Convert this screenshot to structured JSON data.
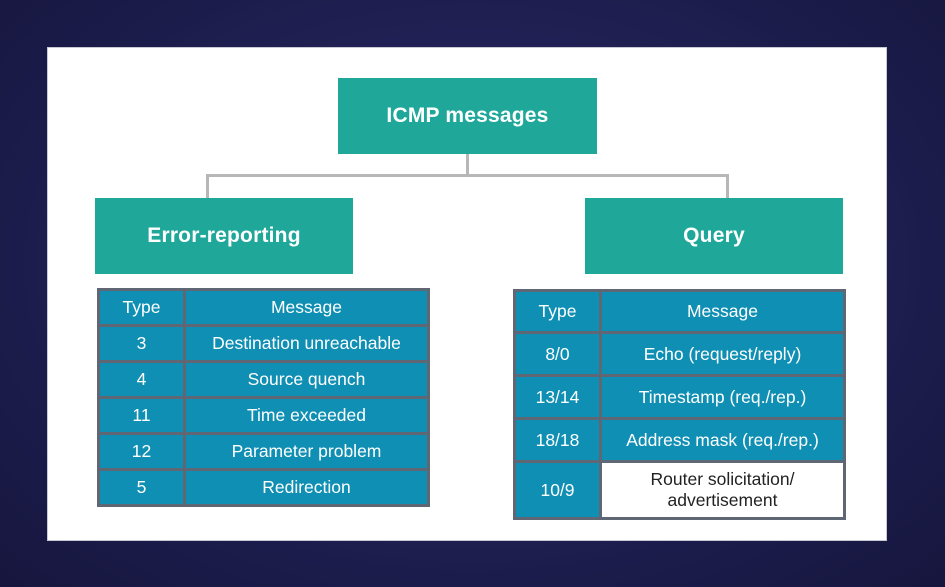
{
  "root": {
    "label": "ICMP messages"
  },
  "error_reporting": {
    "label": "Error-reporting",
    "header": {
      "type": "Type",
      "message": "Message"
    },
    "rows": [
      {
        "type": "3",
        "message": "Destination unreachable"
      },
      {
        "type": "4",
        "message": "Source quench"
      },
      {
        "type": "11",
        "message": "Time exceeded"
      },
      {
        "type": "12",
        "message": "Parameter problem"
      },
      {
        "type": "5",
        "message": "Redirection"
      }
    ]
  },
  "query": {
    "label": "Query",
    "header": {
      "type": "Type",
      "message": "Message"
    },
    "rows": [
      {
        "type": "8/0",
        "message": "Echo (request/reply)"
      },
      {
        "type": "13/14",
        "message": "Timestamp (req./rep.)"
      },
      {
        "type": "18/18",
        "message": "Address mask (req./rep.)"
      },
      {
        "type": "10/9",
        "message": "Router solicitation/ advertisement"
      }
    ]
  },
  "colors": {
    "teal_box": "#1fa89a",
    "table_cell": "#0f8fb3",
    "table_border": "#5f6775",
    "connector": "#b7b7b7"
  }
}
